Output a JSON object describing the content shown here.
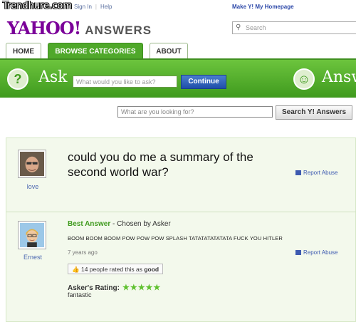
{
  "watermark": "Trendhure.com",
  "top_links": {
    "sign_in": "Sign In",
    "help": "Help",
    "make_homepage": "Make Y! My Homepage"
  },
  "logo": {
    "yahoo": "YAHOO!",
    "answers": "ANSWERS"
  },
  "header_search": {
    "placeholder": "Search"
  },
  "tabs": [
    {
      "label": "HOME"
    },
    {
      "label": "BROWSE CATEGORIES"
    },
    {
      "label": "ABOUT"
    }
  ],
  "ask_bar": {
    "ask_label": "Ask",
    "ask_placeholder": "What would you like to ask?",
    "continue_label": "Continue",
    "answer_label": "Answ"
  },
  "lookup": {
    "placeholder": "What are you looking for?",
    "button_label": "Search Y! Answers"
  },
  "question": {
    "asker_name": "love",
    "text": "could you do me a summary of the second world war?",
    "report_label": "Report Abuse"
  },
  "best_answer": {
    "heading": "Best Answer",
    "chosen_by": "- Chosen by Asker",
    "answerer_name": "Ernest",
    "text": "BOOM BOOM BOOM POW POW POW SPLASH TATATATATATATA  FUCK YOU HITLER",
    "time_ago": "7 years ago",
    "report_label": "Report Abuse",
    "rated_count_text": "14 people rated this as",
    "rated_value": "good",
    "asker_rating_label": "Asker's Rating:",
    "stars": "★★★★★",
    "asker_comment": "fantastic"
  },
  "colors": {
    "green": "#4fa82a",
    "purple": "#7b0099",
    "link_blue": "#3d5ab0"
  }
}
